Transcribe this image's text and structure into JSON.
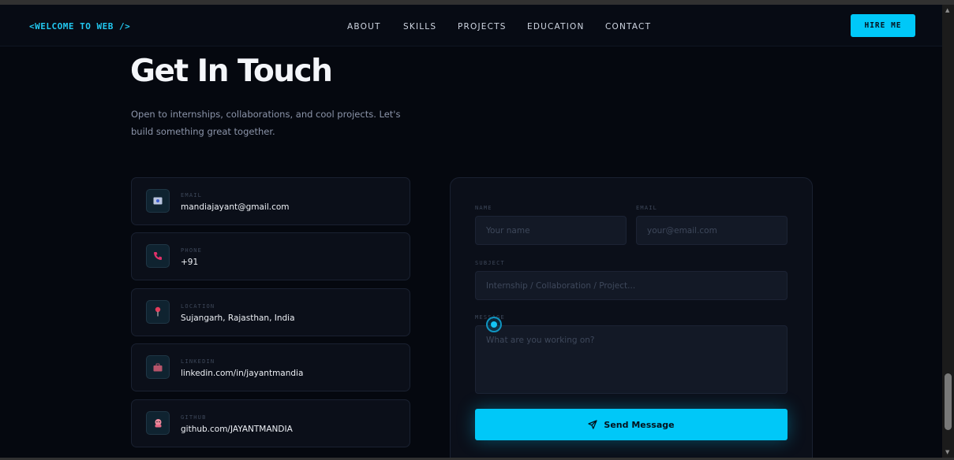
{
  "nav": {
    "logo": "<WELCOME TO WEB />",
    "links": [
      "ABOUT",
      "SKILLS",
      "PROJECTS",
      "EDUCATION",
      "CONTACT"
    ],
    "hire_label": "HIRE ME"
  },
  "hero": {
    "title": "Get In Touch",
    "subtitle": "Open to internships, collaborations, and cool projects. Let's build something great together."
  },
  "contact_cards": [
    {
      "label": "EMAIL",
      "value": "mandiajayant@gmail.com",
      "icon": "envelope-icon"
    },
    {
      "label": "PHONE",
      "value": "+91",
      "icon": "phone-icon"
    },
    {
      "label": "LOCATION",
      "value": "Sujangarh, Rajasthan, India",
      "icon": "pin-icon"
    },
    {
      "label": "LINKEDIN",
      "value": "linkedin.com/in/jayantmandia",
      "icon": "briefcase-icon"
    },
    {
      "label": "GITHUB",
      "value": "github.com/JAYANTMANDIA",
      "icon": "octopus-icon"
    }
  ],
  "form": {
    "name_label": "NAME",
    "name_placeholder": "Your name",
    "email_label": "EMAIL",
    "email_placeholder": "your@email.com",
    "subject_label": "SUBJECT",
    "subject_placeholder": "Internship / Collaboration / Project...",
    "message_label": "MESSAGE",
    "message_placeholder": "What are you working on?",
    "send_label": "Send Message"
  },
  "colors": {
    "accent": "#00c8f8",
    "background": "#05080f",
    "card": "#0b0f19"
  }
}
